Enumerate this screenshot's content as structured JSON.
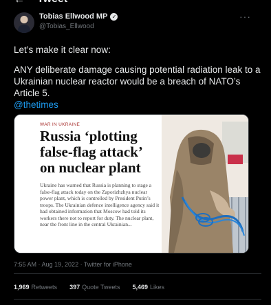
{
  "header": {
    "title": "Tweet",
    "back_icon": "back-arrow-icon"
  },
  "author": {
    "name": "Tobias Ellwood MP",
    "handle": "@Tobias_Ellwood",
    "verified_icon": "verified-badge-icon"
  },
  "tweet": {
    "line1": "Let’s make it clear now:",
    "line2": "ANY deliberate damage causing potential radiation leak to a Ukrainian nuclear reactor would be a breach of NATO’s Article 5.",
    "mention": "@thetimes"
  },
  "card": {
    "kicker": "WAR IN UKRAINE",
    "headline": "Russia ‘plotting false-flag attack’ on nuclear plant",
    "body": "Ukraine has warned that Russia is planning to stage a false-flag attack today on the Zaporizhzhya nuclear power plant, which is controlled by President Putin’s troops. The Ukrainian defence intelligence agency said it had obtained information that Moscow had told its workers there not to report for duty. The nuclear plant, near the front line in the central Ukrainian..."
  },
  "meta": "7:55 AM · Aug 19, 2022 · Twitter for iPhone",
  "stats": {
    "retweets_count": "1,969",
    "retweets_label": "Retweets",
    "quotes_count": "397",
    "quotes_label": "Quote Tweets",
    "likes_count": "5,469",
    "likes_label": "Likes"
  },
  "colors": {
    "background": "#000000",
    "text": "#e7e9ea",
    "muted": "#71767b",
    "link": "#1d9bf0",
    "kicker": "#a8302e"
  }
}
